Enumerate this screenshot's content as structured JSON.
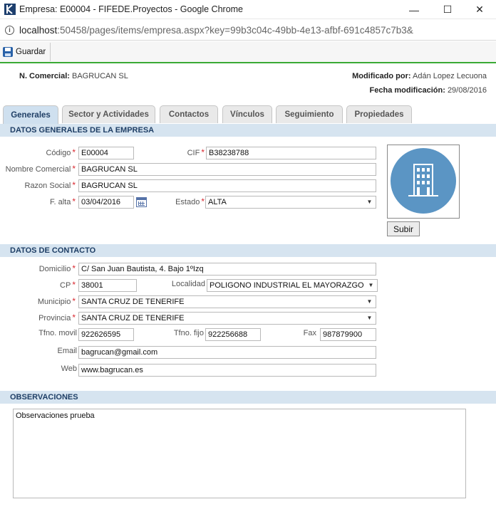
{
  "window": {
    "title": "Empresa: E00004 - FIFEDE.Proyectos - Google Chrome",
    "minimize_glyph": "—",
    "maximize_glyph": "☐",
    "close_glyph": "✕"
  },
  "address": {
    "host": "localhost",
    "path": ":50458/pages/items/empresa.aspx?key=99b3c04c-49bb-4e13-afbf-691c4857c7b3&"
  },
  "toolbar": {
    "save_label": "Guardar"
  },
  "header": {
    "nombre_label": "N. Comercial:",
    "nombre_value": "BAGRUCAN SL",
    "modificado_label": "Modificado por:",
    "modificado_value": "Adán Lopez Lecuona",
    "fecha_label": "Fecha modificación:",
    "fecha_value": "29/08/2016"
  },
  "tabs": [
    "Generales",
    "Sector y Actividades",
    "Contactos",
    "Vínculos",
    "Seguimiento",
    "Propiedades"
  ],
  "sections": {
    "generales": "DATOS GENERALES DE LA EMPRESA",
    "contacto": "DATOS DE CONTACTO",
    "observaciones": "OBSERVACIONES"
  },
  "generales": {
    "codigo_label": "Código",
    "codigo_value": "E00004",
    "cif_label": "CIF",
    "cif_value": "B38238788",
    "nombre_label": "Nombre Comercial",
    "nombre_value": "BAGRUCAN SL",
    "razon_label": "Razon Social",
    "razon_value": "BAGRUCAN SL",
    "falta_label": "F. alta",
    "falta_value": "03/04/2016",
    "estado_label": "Estado",
    "estado_value": "ALTA",
    "subir_label": "Subir"
  },
  "contacto": {
    "domicilio_label": "Domicilio",
    "domicilio_value": "C/ San Juan Bautista, 4. Bajo 1ºIzq",
    "cp_label": "CP",
    "cp_value": "38001",
    "localidad_label": "Localidad",
    "localidad_value": "POLIGONO INDUSTRIAL EL MAYORAZGO",
    "municipio_label": "Municipio",
    "municipio_value": "SANTA CRUZ DE TENERIFE",
    "provincia_label": "Provincia",
    "provincia_value": "SANTA CRUZ DE TENERIFE",
    "movil_label": "Tfno. movil",
    "movil_value": "922626595",
    "fijo_label": "Tfno. fijo",
    "fijo_value": "922256688",
    "fax_label": "Fax",
    "fax_value": "987879900",
    "email_label": "Email",
    "email_value": "bagrucan@gmail.com",
    "web_label": "Web",
    "web_value": "www.bagrucan.es"
  },
  "observaciones": {
    "value": "Observaciones prueba"
  },
  "colors": {
    "accent": "#3aaa35",
    "section": "#d6e4f0",
    "required": "#d9282f",
    "avatar": "#5b95c4"
  }
}
